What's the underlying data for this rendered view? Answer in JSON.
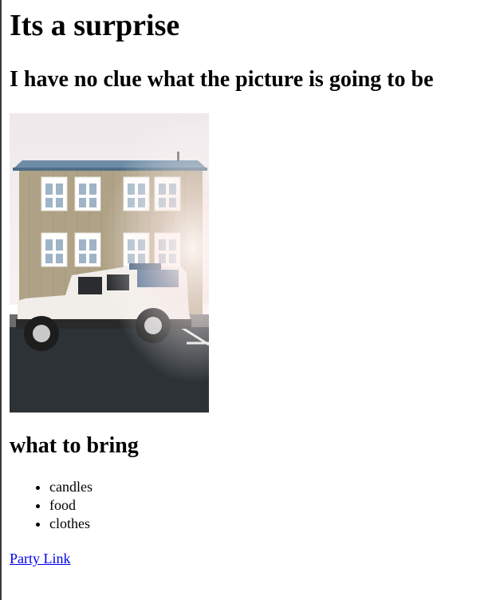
{
  "page": {
    "title": "Its a surprise",
    "subtitle": "I have no clue what the picture is going to be",
    "list_heading": "what to bring",
    "items": [
      "candles",
      "food",
      "clothes"
    ],
    "link_text": "Party Link"
  },
  "photo": {
    "subject": "house-with-white-suv-photo",
    "colors": {
      "sky": "#f3eef0",
      "wall": "#b3a589",
      "roof": "#6f8ea8",
      "car": "#f2efea",
      "road": "#2c3136",
      "flare": "#fff4ea"
    }
  }
}
